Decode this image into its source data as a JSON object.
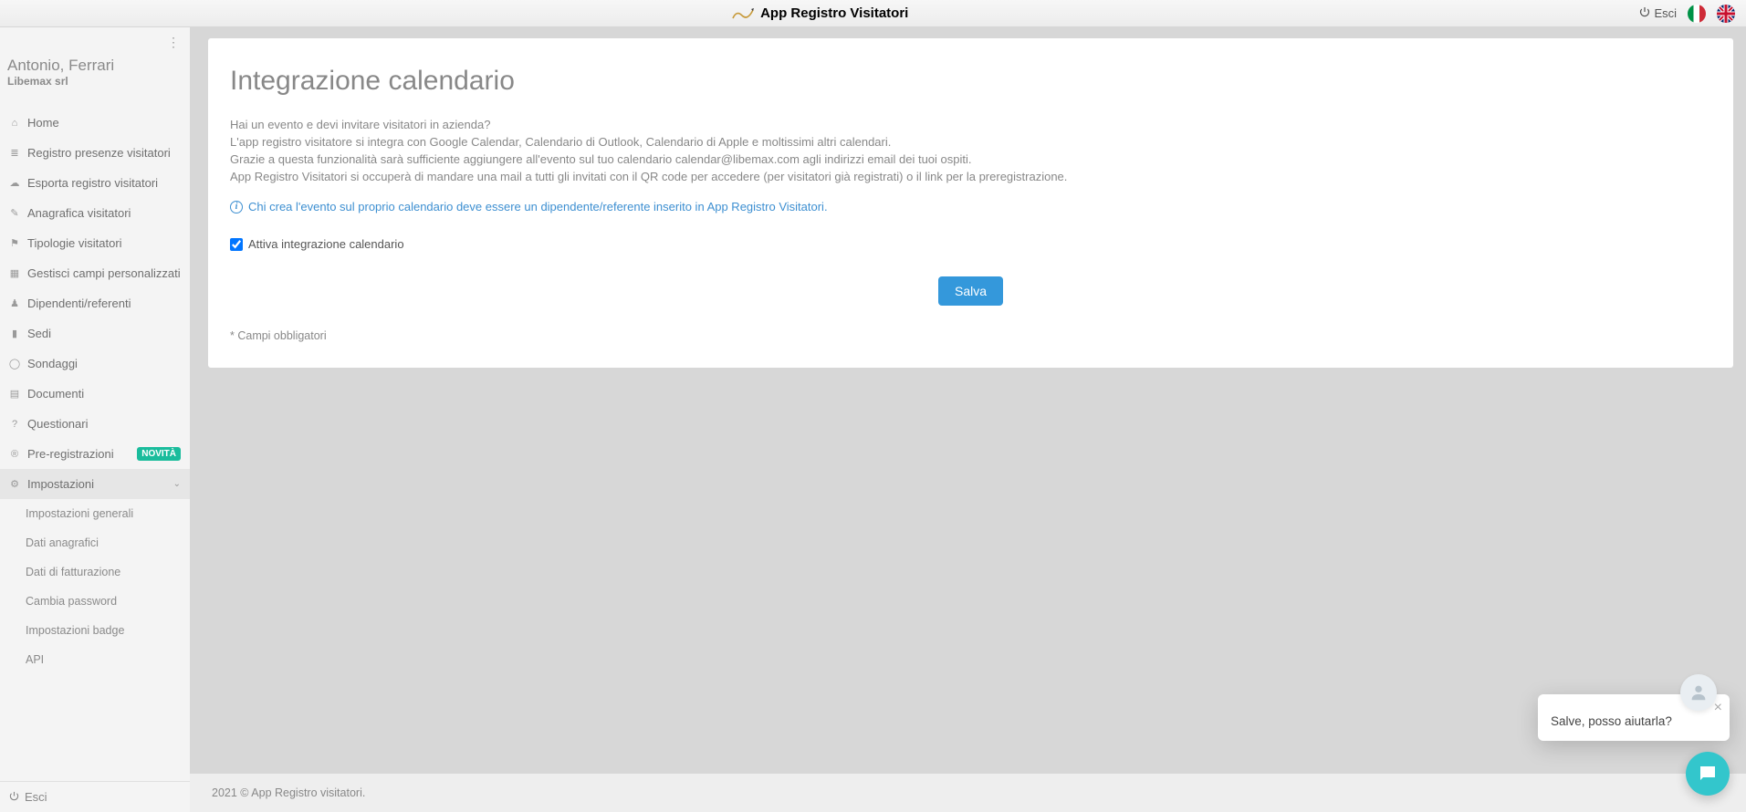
{
  "header": {
    "app_title": "App Registro Visitatori",
    "logout_label": "Esci"
  },
  "user": {
    "name": "Antonio, Ferrari",
    "company": "Libemax srl"
  },
  "sidebar": {
    "items": [
      {
        "label": "Home",
        "icon": "home"
      },
      {
        "label": "Registro presenze visitatori",
        "icon": "list"
      },
      {
        "label": "Esporta registro visitatori",
        "icon": "cloud"
      },
      {
        "label": "Anagrafica visitatori",
        "icon": "edit"
      },
      {
        "label": "Tipologie visitatori",
        "icon": "flag"
      },
      {
        "label": "Gestisci campi personalizzati",
        "icon": "grid"
      },
      {
        "label": "Dipendenti/referenti",
        "icon": "user"
      },
      {
        "label": "Sedi",
        "icon": "building"
      },
      {
        "label": "Sondaggi",
        "icon": "circle"
      },
      {
        "label": "Documenti",
        "icon": "file"
      },
      {
        "label": "Questionari",
        "icon": "question"
      },
      {
        "label": "Pre-registrazioni",
        "icon": "register",
        "badge": "NOVITÀ"
      },
      {
        "label": "Impostazioni",
        "icon": "cogs",
        "expandable": true
      }
    ],
    "sub_impostazioni": [
      {
        "label": "Impostazioni generali"
      },
      {
        "label": "Dati anagrafici"
      },
      {
        "label": "Dati di fatturazione"
      },
      {
        "label": "Cambia password"
      },
      {
        "label": "Impostazioni badge"
      },
      {
        "label": "API"
      }
    ],
    "footer_logout": "Esci"
  },
  "page": {
    "title": "Integrazione calendario",
    "intro_line1": "Hai un evento e devi invitare visitatori in azienda?",
    "intro_line2": "L'app registro visitatore si integra con Google Calendar, Calendario di Outlook, Calendario di Apple e moltissimi altri calendari.",
    "intro_line3": "Grazie a questa funzionalità sarà sufficiente aggiungere all'evento sul tuo calendario calendar@libemax.com agli indirizzi email dei tuoi ospiti.",
    "intro_line4": "App Registro Visitatori si occuperà di mandare una mail a tutti gli invitati con il QR code per accedere (per visitatori già registrati) o il link per la preregistrazione.",
    "info_note": "Chi crea l'evento sul proprio calendario deve essere un dipendente/referente inserito in App Registro Visitatori.",
    "checkbox_label": "Attiva integrazione calendario",
    "checkbox_checked": true,
    "save_label": "Salva",
    "required_note": "* Campi obbligatori"
  },
  "footer": {
    "text": "2021 © App Registro visitatori."
  },
  "chat": {
    "message": "Salve, posso aiutarla?"
  }
}
